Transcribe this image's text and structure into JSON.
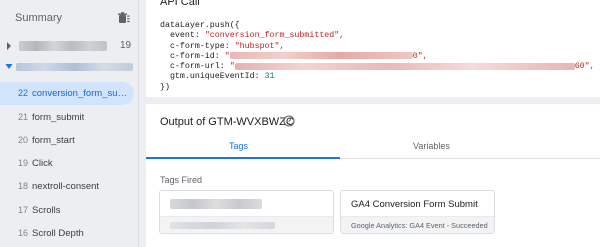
{
  "sidebar": {
    "title": "Summary",
    "collapsed_group": {
      "count": "19"
    },
    "expanded_group": {},
    "items": [
      {
        "index": "22",
        "label": "conversion_form_submi...",
        "active": true
      },
      {
        "index": "21",
        "label": "form_submit"
      },
      {
        "index": "20",
        "label": "form_start"
      },
      {
        "index": "19",
        "label": "Click"
      },
      {
        "index": "18",
        "label": "nextroll-consent"
      },
      {
        "index": "17",
        "label": "Scrolls"
      },
      {
        "index": "16",
        "label": "Scroll Depth"
      }
    ]
  },
  "api_call": {
    "title": "API Call",
    "code": {
      "l1": "dataLayer.push({",
      "event_key": "  event: ",
      "event_val": "\"conversion_form_submitted\",",
      "type_key": "  c-form-type: ",
      "type_val": "\"hubspot\",",
      "id_key": "  c-form-id: ",
      "id_val_tail": "0\",",
      "url_key": "  c-form-url: ",
      "url_val_head": "\"",
      "url_val_tail": "60\",",
      "gtm_key": "  gtm.uniqueEventId: ",
      "gtm_val": "31",
      "last": "})"
    }
  },
  "output": {
    "title": "Output of GTM-WVXBWZC",
    "tabs": {
      "tags": "Tags",
      "variables": "Variables"
    },
    "tags_fired_label": "Tags Fired",
    "tags": [
      {
        "name": "",
        "subtitle": ""
      },
      {
        "name": "GA4 Conversion Form Submit",
        "subtitle": "Google Analytics: GA4 Event - Succeeded"
      }
    ]
  },
  "colors": {
    "accent": "#1a73e8",
    "active_bg": "#d2e3fc",
    "string": "#c5221f",
    "number": "#188038"
  },
  "icons": {
    "trash": "trash-icon",
    "help": "help-icon",
    "caret_right": "caret-right-icon",
    "caret_down": "caret-down-icon"
  }
}
